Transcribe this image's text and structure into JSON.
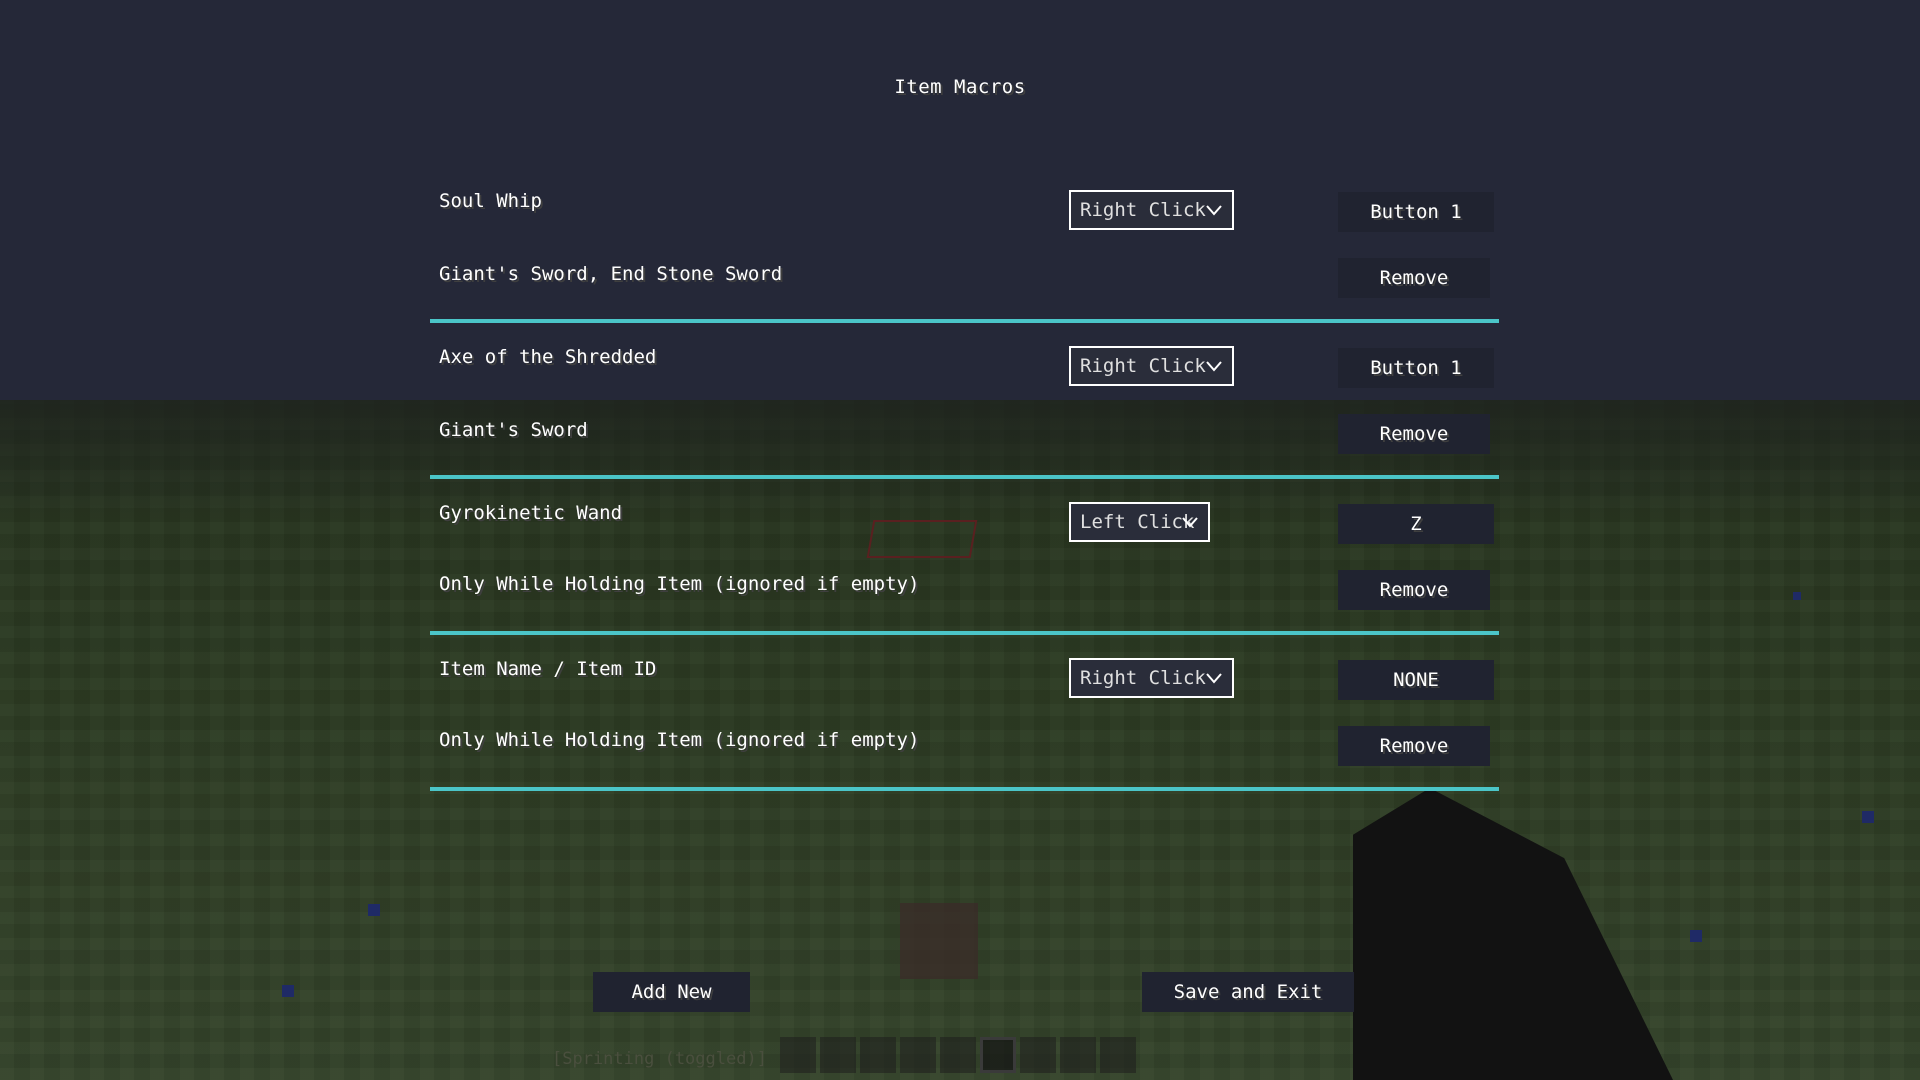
{
  "title": "Item Macros",
  "macros": [
    {
      "item": "Soul Whip",
      "click_type": "Right Click",
      "keybind": "Button 1",
      "holding": "Giant's Sword, End Stone Sword",
      "remove_label": "Remove"
    },
    {
      "item": "Axe of the Shredded",
      "click_type": "Right Click",
      "keybind": "Button 1",
      "holding": "Giant's Sword",
      "remove_label": "Remove"
    },
    {
      "item": "Gyrokinetic Wand",
      "click_type": "Left Click",
      "keybind": "Z",
      "holding": "Only While Holding Item (ignored if empty)",
      "remove_label": "Remove"
    },
    {
      "item": "Item Name / Item ID",
      "click_type": "Right Click",
      "keybind": "NONE",
      "holding": "Only While Holding Item (ignored if empty)",
      "remove_label": "Remove"
    }
  ],
  "buttons": {
    "add_new": "Add New",
    "save_exit": "Save and Exit"
  },
  "hud": {
    "status": "[Sprinting (toggled)]",
    "selected_slot": 5
  },
  "colors": {
    "divider": "#4bc5c8",
    "button_bg": "#202330",
    "sky": "#252838",
    "ground": "#2b3a22"
  },
  "icons": {
    "dropdown": "chevron-down-icon"
  }
}
